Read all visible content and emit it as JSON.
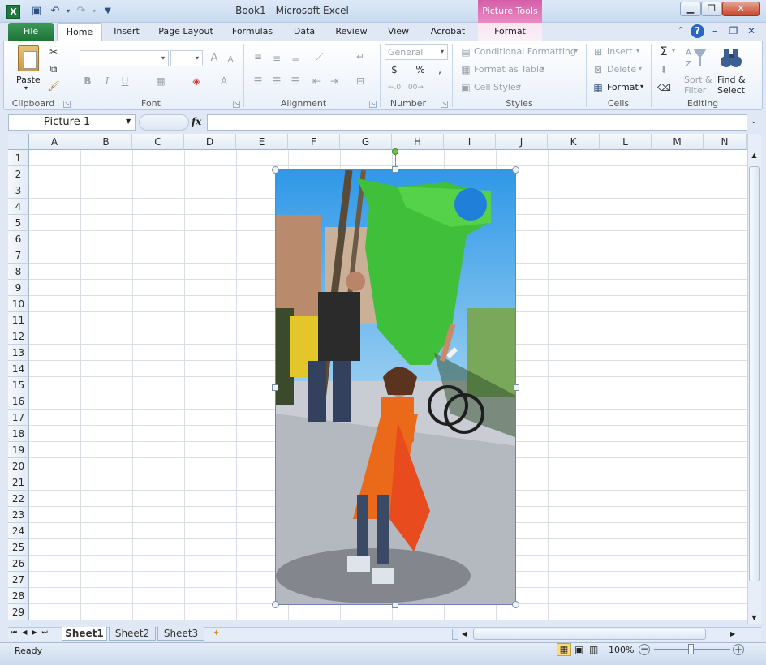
{
  "window": {
    "title": "Book1  -  Microsoft Excel",
    "context_tab": "Picture Tools"
  },
  "tabs": [
    "File",
    "Home",
    "Insert",
    "Page Layout",
    "Formulas",
    "Data",
    "Review",
    "View",
    "Acrobat",
    "Format"
  ],
  "ribbon": {
    "clipboard": {
      "paste": "Paste",
      "label": "Clipboard"
    },
    "font": {
      "label": "Font"
    },
    "alignment": {
      "label": "Alignment"
    },
    "number": {
      "format": "General",
      "currency": "$",
      "percent": "%",
      "comma": ",",
      "label": "Number"
    },
    "styles": {
      "conditional": "Conditional Formatting",
      "as_table": "Format as Table",
      "cell_styles": "Cell Styles",
      "label": "Styles"
    },
    "cells": {
      "insert": "Insert",
      "delete": "Delete",
      "format": "Format",
      "label": "Cells"
    },
    "editing": {
      "sum": "Σ",
      "sort_1": "Sort &",
      "sort_2": "Filter",
      "find_1": "Find &",
      "find_2": "Select",
      "label": "Editing"
    }
  },
  "formula_bar": {
    "name_box": "Picture 1",
    "fx": "fx",
    "formula": ""
  },
  "columns": [
    "A",
    "B",
    "C",
    "D",
    "E",
    "F",
    "G",
    "H",
    "I",
    "J",
    "K",
    "L",
    "M",
    "N"
  ],
  "rows": [
    "1",
    "2",
    "3",
    "4",
    "5",
    "6",
    "7",
    "8",
    "9",
    "10",
    "11",
    "12",
    "13",
    "14",
    "15",
    "16",
    "17",
    "18",
    "19",
    "20",
    "21",
    "22",
    "23",
    "24",
    "25",
    "26",
    "27",
    "28",
    "29"
  ],
  "sheets": [
    "Sheet1",
    "Sheet2",
    "Sheet3"
  ],
  "status": {
    "text": "Ready",
    "zoom": "100%"
  }
}
